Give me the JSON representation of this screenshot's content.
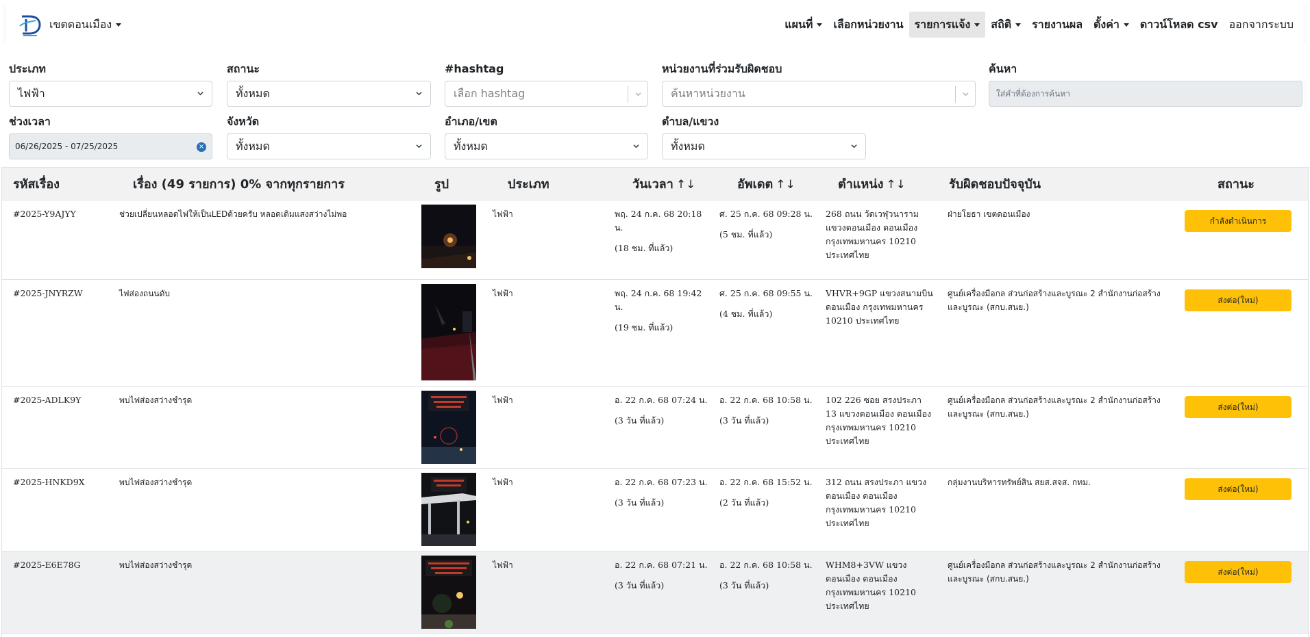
{
  "navbar": {
    "brand": "เขตดอนเมือง",
    "items": [
      {
        "label": "แผนที่",
        "dropdown": true
      },
      {
        "label": "เลือกหน่วยงาน",
        "dropdown": false
      },
      {
        "label": "รายการแจ้ง",
        "dropdown": true,
        "active": true
      },
      {
        "label": "สถิติ",
        "dropdown": true
      },
      {
        "label": "รายงานผล",
        "dropdown": false
      },
      {
        "label": "ตั้งค่า",
        "dropdown": true
      },
      {
        "label": "ดาวน์โหลด csv",
        "dropdown": false
      },
      {
        "label": "ออกจากระบบ",
        "dropdown": false
      }
    ]
  },
  "filters": {
    "type": {
      "label": "ประเภท",
      "value": "ไฟฟ้า"
    },
    "status": {
      "label": "สถานะ",
      "value": "ทั้งหมด"
    },
    "hashtag": {
      "label": "#hashtag",
      "placeholder": "เลือก hashtag"
    },
    "agency": {
      "label": "หน่วยงานที่ร่วมรับผิดชอบ",
      "placeholder": "ค้นหาหน่วยงาน"
    },
    "search": {
      "label": "ค้นหา",
      "placeholder": "ใส่คำที่ต้องการค้นหา"
    },
    "period": {
      "label": "ช่วงเวลา",
      "value": "06/26/2025 - 07/25/2025"
    },
    "province": {
      "label": "จังหวัด",
      "value": "ทั้งหมด"
    },
    "district": {
      "label": "อำเภอ/เขต",
      "value": "ทั้งหมด"
    },
    "subdistrict": {
      "label": "ตำบล/แขวง",
      "value": "ทั้งหมด"
    }
  },
  "table": {
    "headers": {
      "id": "รหัสเรื่อง",
      "title": "เรื่อง (49 รายการ) 0% จากทุกรายการ",
      "image": "รูป",
      "type": "ประเภท",
      "time": "วันเวลา",
      "updated": "อัพเดต",
      "location": "ตำแหน่ง",
      "responsible": "รับผิดชอบปัจจุบัน",
      "status": "สถานะ",
      "sort_glyph": "↑↓"
    },
    "rows": [
      {
        "id": "#2025-Y9AJYY",
        "title": "ช่วยเปลี่ยนหลอดไฟให้เป็นLEDด้วยครับ หลอดเดิมแสงสว่างไม่พอ",
        "type": "ไฟฟ้า",
        "time": "พฤ. 24 ก.ค. 68 20:18 น.",
        "time_rel": "(18 ชม. ที่แล้ว)",
        "updated": "ศ. 25 ก.ค. 68 09:28 น.",
        "updated_rel": "(5 ชม. ที่แล้ว)",
        "location": "268 ถนน วัดเวฬุวนาราม แขวงดอนเมือง ดอนเมือง กรุงเทพมหานคร 10210 ประเทศไทย",
        "responsible": "ฝ่ายโยธา เขตดอนเมือง",
        "status": "กำลังดำเนินการ",
        "thumb": "night-street-lamp"
      },
      {
        "id": "#2025-JNYRZW",
        "title": "ไฟส่องถนนดับ",
        "type": "ไฟฟ้า",
        "time": "พฤ. 24 ก.ค. 68 19:42 น.",
        "time_rel": "(19 ชม. ที่แล้ว)",
        "updated": "ศ. 25 ก.ค. 68 09:55 น.",
        "updated_rel": "(4 ชม. ที่แล้ว)",
        "location": "VHVR+9GP แขวงสนามบิน ดอนเมือง กรุงเทพมหานคร 10210 ประเทศไทย",
        "responsible": "ศูนย์เครื่องมือกล ส่วนก่อสร้างและบูรณะ 2 สำนักงานก่อสร้างและบูรณะ (สกบ.สนย.)",
        "status": "ส่งต่อ(ใหม่)",
        "thumb": "dark-road"
      },
      {
        "id": "#2025-ADLK9Y",
        "title": "พบไฟส่องสว่างชำรุด",
        "type": "ไฟฟ้า",
        "time": "อ. 22 ก.ค. 68 07:24 น.",
        "time_rel": "(3 วัน ที่แล้ว)",
        "updated": "อ. 22 ก.ค. 68 10:58 น.",
        "updated_rel": "(3 วัน ที่แล้ว)",
        "location": "102 226 ซอย สรงประภา 13 แขวงดอนเมือง ดอนเมือง กรุงเทพมหานคร 10210 ประเทศไทย",
        "responsible": "ศูนย์เครื่องมือกล ส่วนก่อสร้างและบูรณะ 2 สำนักงานก่อสร้างและบูรณะ (สกบ.สนย.)",
        "status": "ส่งต่อ(ใหม่)",
        "thumb": "night-intersection"
      },
      {
        "id": "#2025-HNKD9X",
        "title": "พบไฟส่องสว่างชำรุด",
        "type": "ไฟฟ้า",
        "time": "อ. 22 ก.ค. 68 07:23 น.",
        "time_rel": "(3 วัน ที่แล้ว)",
        "updated": "อ. 22 ก.ค. 68 15:52 น.",
        "updated_rel": "(2 วัน ที่แล้ว)",
        "location": "312 ถนน สรงประภา แขวงดอนเมือง ดอนเมือง กรุงเทพมหานคร 10210 ประเทศไทย",
        "responsible": "กลุ่มงานบริหารทรัพย์สิน สยส.สจส. กทม.",
        "status": "ส่งต่อ(ใหม่)",
        "thumb": "bus-shelter"
      },
      {
        "id": "#2025-E6E78G",
        "title": "พบไฟส่องสว่างชำรุด",
        "type": "ไฟฟ้า",
        "time": "อ. 22 ก.ค. 68 07:21 น.",
        "time_rel": "(3 วัน ที่แล้ว)",
        "updated": "อ. 22 ก.ค. 68 10:58 น.",
        "updated_rel": "(3 วัน ที่แล้ว)",
        "location": "WHM8+3VW แขวงดอนเมือง ดอนเมือง กรุงเทพมหานคร 10210 ประเทศไทย",
        "responsible": "ศูนย์เครื่องมือกล ส่วนก่อสร้างและบูรณะ 2 สำนักงานก่อสร้างและบูรณะ (สกบ.สนย.)",
        "status": "ส่งต่อ(ใหม่)",
        "thumb": "night-street-tree"
      }
    ]
  },
  "colors": {
    "status_button": "#ffc107",
    "header_bg": "#f2f2f2",
    "shaded_row": "#eef0f2",
    "clear_icon": "#2a6fb6"
  }
}
